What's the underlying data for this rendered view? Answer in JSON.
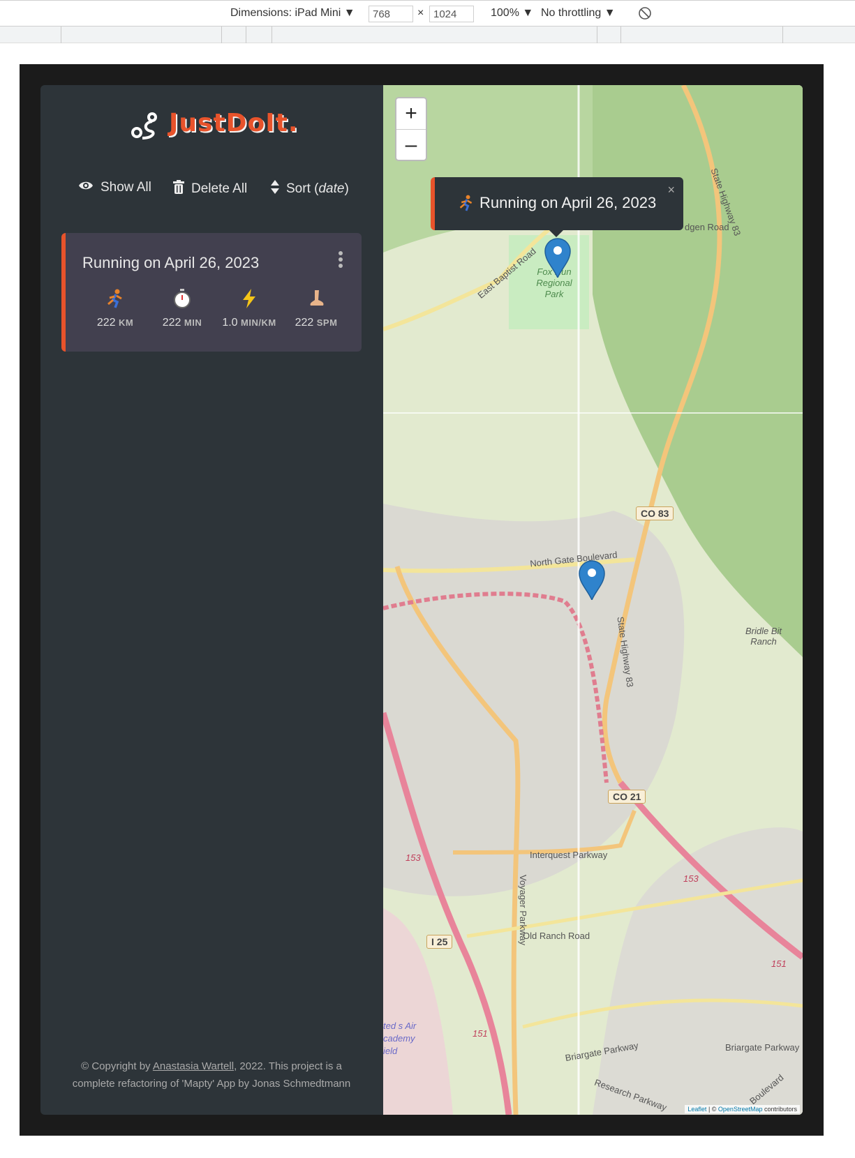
{
  "devtools": {
    "dimensions_label": "Dimensions: iPad Mini ▼",
    "width_value": "768",
    "times": "×",
    "height_value": "1024",
    "zoom": "100% ▼",
    "throttling": "No throttling ▼"
  },
  "app": {
    "logo_text": "JustDoIt.",
    "toolbar": {
      "show_all": "Show All",
      "delete_all": "Delete All",
      "sort_label": "Sort (",
      "sort_key": "date",
      "sort_close": ")"
    },
    "workouts": [
      {
        "title": "Running on April 26, 2023",
        "stats": [
          {
            "icon": "running-icon",
            "value": "222",
            "unit": "KM"
          },
          {
            "icon": "stopwatch-icon",
            "value": "222",
            "unit": "MIN"
          },
          {
            "icon": "lightning-icon",
            "value": "1.0",
            "unit": "MIN/KM"
          },
          {
            "icon": "foot-icon",
            "value": "222",
            "unit": "SPM"
          }
        ]
      }
    ],
    "footer": {
      "prefix": "© Copyright by ",
      "author": "Anastasia Wartell",
      "suffix": ", 2022. This project is a complete refactoring of 'Mapty' App by Jonas Schmedtmann"
    }
  },
  "map": {
    "zoom_in": "+",
    "zoom_out": "–",
    "popup_text": "Running on April 26, 2023",
    "popup_close": "×",
    "labels": {
      "park": "Fox Run Regional Park",
      "east_baptist": "East Baptist Road",
      "north_gate": "North Gate Boulevard",
      "state_hwy": "State Highway 83",
      "bridle": "Bridle Bit Ranch",
      "interquest": "Interquest Parkway",
      "voyager": "Voyager Parkway",
      "old_ranch": "Old Ranch Road",
      "briargate": "Briargate Parkway",
      "research": "Research Parkway",
      "academy": "ted s Air cademy ield",
      "hodgen": "dgen Road",
      "boulevard": "Boulevard"
    },
    "shields": {
      "co83": "CO 83",
      "co21": "CO 21",
      "i25": "I 25",
      "r153": "153",
      "r151": "151"
    },
    "attribution_leaflet": "Leaflet",
    "attribution_sep": " | © ",
    "attribution_osm": "OpenStreetMap",
    "attribution_tail": " contributors"
  },
  "colors": {
    "accent": "#e8532b",
    "sidebar": "#2d3439",
    "card": "#42404f"
  }
}
